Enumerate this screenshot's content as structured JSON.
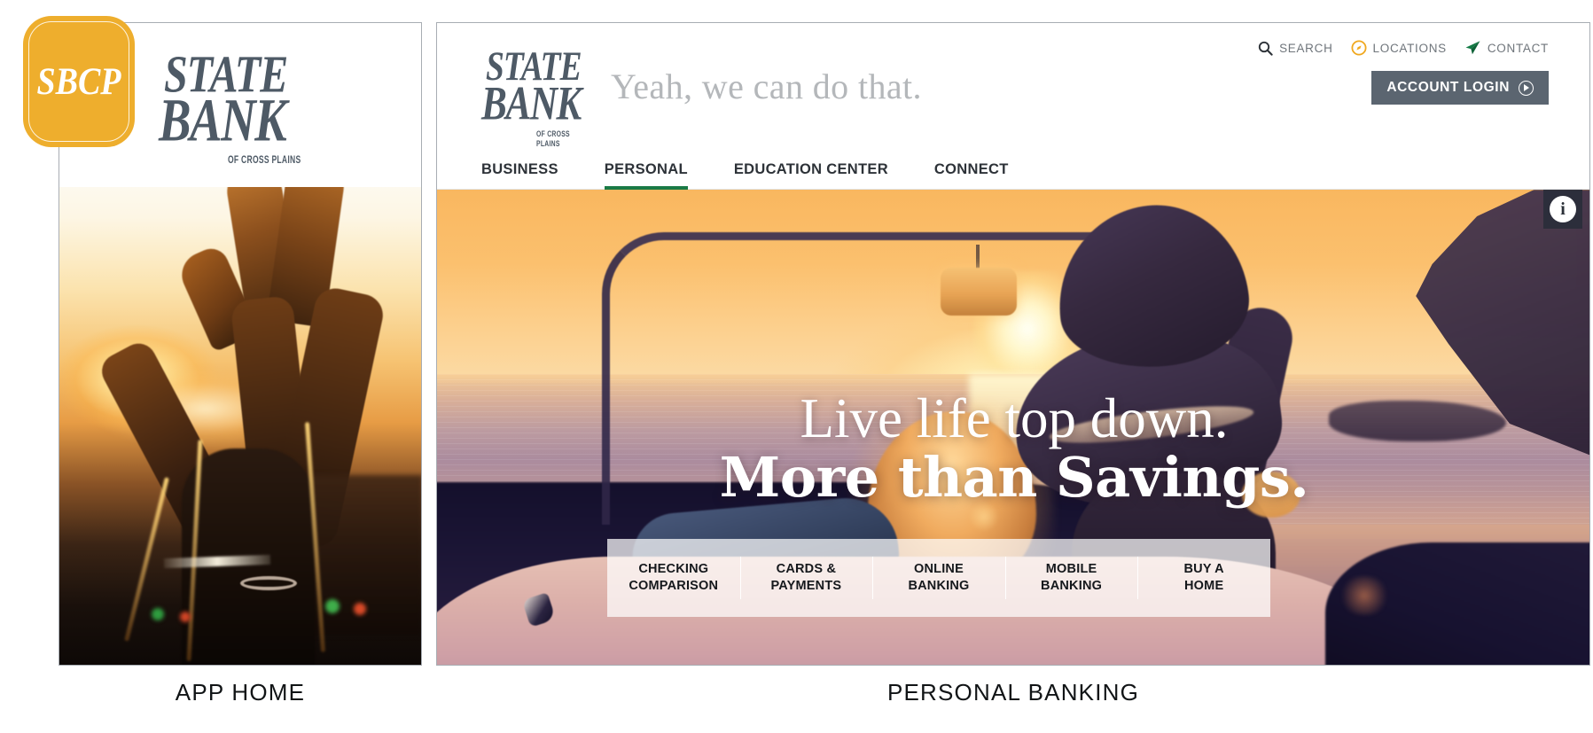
{
  "left_panel": {
    "caption": "APP HOME",
    "app_badge": {
      "label": "SBCP",
      "color": "#eeae2d"
    },
    "logo": {
      "line1": "STATE",
      "line2": "BANK",
      "subtitle": "OF CROSS PLAINS",
      "color": "#4e5a66"
    },
    "photo_alt": "High-five hands silhouetted against golden sunset"
  },
  "right_panel": {
    "caption": "PERSONAL BANKING",
    "header": {
      "logo": {
        "line1": "STATE",
        "line2": "BANK",
        "subtitle": "OF CROSS PLAINS"
      },
      "tagline": "Yeah, we can do that.",
      "utility_nav": [
        {
          "label": "SEARCH",
          "icon": "search-icon"
        },
        {
          "label": "LOCATIONS",
          "icon": "compass-icon"
        },
        {
          "label": "CONTACT",
          "icon": "paper-plane-icon"
        }
      ],
      "account_login": {
        "label": "ACCOUNT LOGIN",
        "icon": "play-circle-icon"
      },
      "main_nav": [
        {
          "label": "BUSINESS",
          "active": false
        },
        {
          "label": "PERSONAL",
          "active": true
        },
        {
          "label": "EDUCATION CENTER",
          "active": false
        },
        {
          "label": "CONNECT",
          "active": false
        }
      ],
      "active_underline_color": "#1a7a46"
    },
    "hero": {
      "headline_line1": "Live life top down.",
      "headline_line2": "More than Savings.",
      "image_alt": "Couple in convertible at beach sunset",
      "info_badge": "i",
      "quick_links": [
        {
          "line1": "CHECKING",
          "line2": "COMPARISON"
        },
        {
          "line1": "CARDS &",
          "line2": "PAYMENTS"
        },
        {
          "line1": "ONLINE",
          "line2": "BANKING"
        },
        {
          "line1": "MOBILE",
          "line2": "BANKING"
        },
        {
          "line1": "BUY A",
          "line2": "HOME"
        }
      ]
    }
  }
}
